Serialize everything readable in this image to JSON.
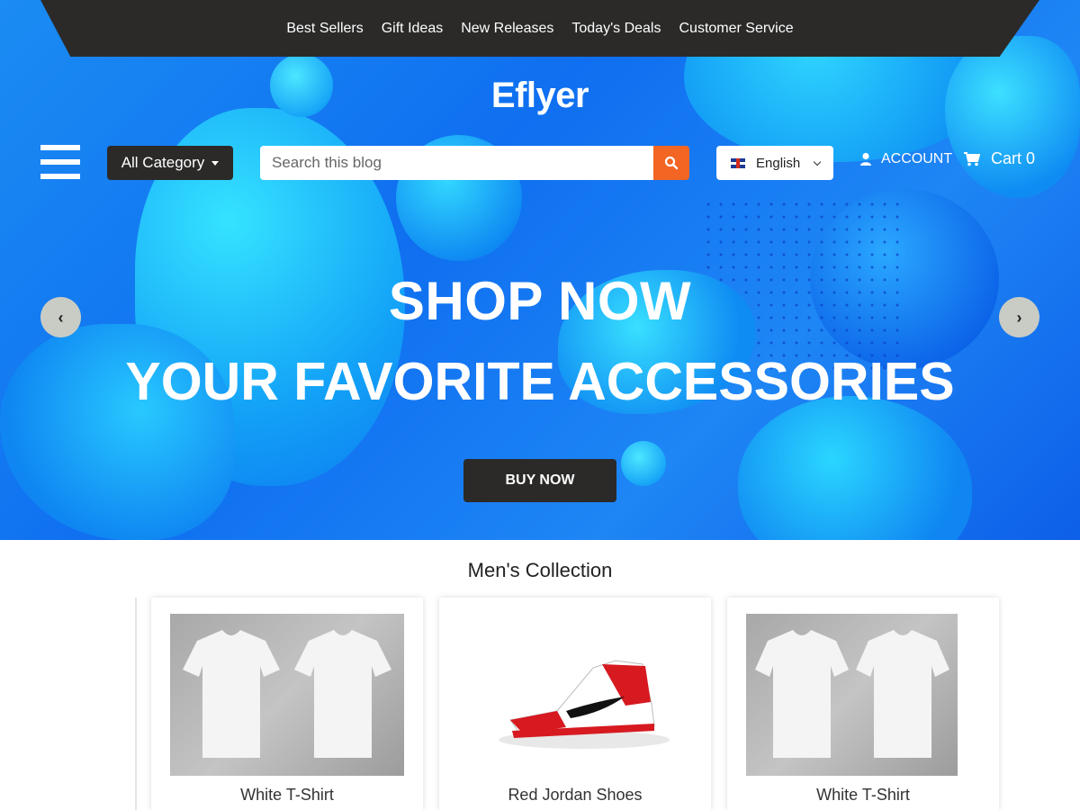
{
  "topnav": {
    "links": [
      "Best Sellers",
      "Gift Ideas",
      "New Releases",
      "Today's Deals",
      "Customer Service"
    ]
  },
  "brand": {
    "logo": "Eflyer"
  },
  "toolbar": {
    "category_label": "All Category",
    "search_placeholder": "Search this blog",
    "language": "English",
    "account_label": "ACCOUNT",
    "cart_label": "Cart 0"
  },
  "hero": {
    "line1": "SHOP NOW",
    "line2": "YOUR FAVORITE ACCESSORIES",
    "cta": "BUY NOW",
    "prev_icon": "‹",
    "next_icon": "›"
  },
  "collection": {
    "title": "Men's Collection",
    "products": [
      {
        "name": "White T-Shirt"
      },
      {
        "name": "Red Jordan Shoes"
      },
      {
        "name": "White T-Shirt"
      }
    ]
  },
  "colors": {
    "dark": "#2b2a29",
    "accent_orange": "#f26522",
    "hero_blue": "#1b8cf3"
  }
}
